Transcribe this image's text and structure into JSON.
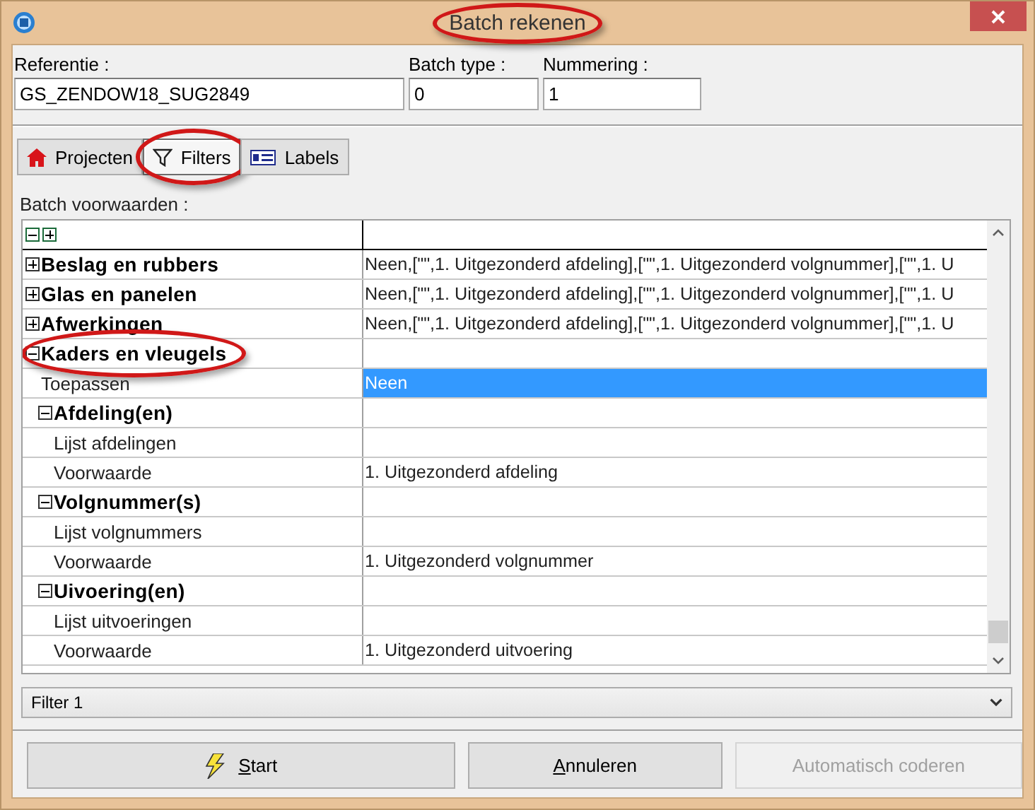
{
  "window": {
    "title": "Batch rekenen",
    "highlighted": true
  },
  "fields": [
    {
      "label": "Referentie :",
      "value": "GS_ZENDOW18_SUG2849"
    },
    {
      "label": "Batch type :",
      "value": "0"
    },
    {
      "label": "Nummering :",
      "value": "1"
    }
  ],
  "tabs": [
    {
      "label": "Projecten",
      "selected": false,
      "highlighted": false
    },
    {
      "label": "Filters",
      "selected": true,
      "highlighted": true
    },
    {
      "label": "Labels",
      "selected": false,
      "highlighted": false
    }
  ],
  "grid_label": "Batch voorwaarden :",
  "rows": [
    {
      "name": "Beslag en rubbers",
      "value": "Neen,[\"\",1. Uitgezonderd afdeling],[\"\",1. Uitgezonderd volgnummer],[\"\",1. U",
      "expanded": false,
      "highlighted": false,
      "selected": false
    },
    {
      "name": "Glas en panelen",
      "value": "Neen,[\"\",1. Uitgezonderd afdeling],[\"\",1. Uitgezonderd volgnummer],[\"\",1. U",
      "expanded": false,
      "highlighted": false,
      "selected": false
    },
    {
      "name": "Afwerkingen",
      "value": "Neen,[\"\",1. Uitgezonderd afdeling],[\"\",1. Uitgezonderd volgnummer],[\"\",1. U",
      "expanded": false,
      "highlighted": false,
      "selected": false
    },
    {
      "name": "Kaders en vleugels",
      "expanded": true,
      "highlighted": true,
      "selected": false,
      "children": [
        {
          "name": "Toepassen",
          "value": "Neen",
          "selected": true
        },
        {
          "name": "Afdeling(en)",
          "expanded": true,
          "selected": false,
          "children": [
            {
              "name": "Lijst afdelingen",
              "selected": false
            },
            {
              "name": "Voorwaarde",
              "value": "1. Uitgezonderd afdeling",
              "selected": false
            }
          ]
        },
        {
          "name": "Volgnummer(s)",
          "expanded": true,
          "selected": false,
          "children": [
            {
              "name": "Lijst volgnummers",
              "selected": false
            },
            {
              "name": "Voorwaarde",
              "value": "1. Uitgezonderd volgnummer",
              "selected": false
            }
          ]
        },
        {
          "name": "Uivoering(en)",
          "expanded": true,
          "selected": false,
          "children": [
            {
              "name": "Lijst uitvoeringen",
              "selected": false
            },
            {
              "name": "Voorwaarde",
              "value": "1. Uitgezonderd uitvoering",
              "selected": false
            }
          ]
        }
      ]
    }
  ],
  "filter_select": {
    "value": "Filter 1"
  },
  "buttons": [
    {
      "label": "Start",
      "disabled": false
    },
    {
      "label": "Annuleren",
      "disabled": false
    },
    {
      "label": "Automatisch coderen",
      "disabled": true
    }
  ]
}
